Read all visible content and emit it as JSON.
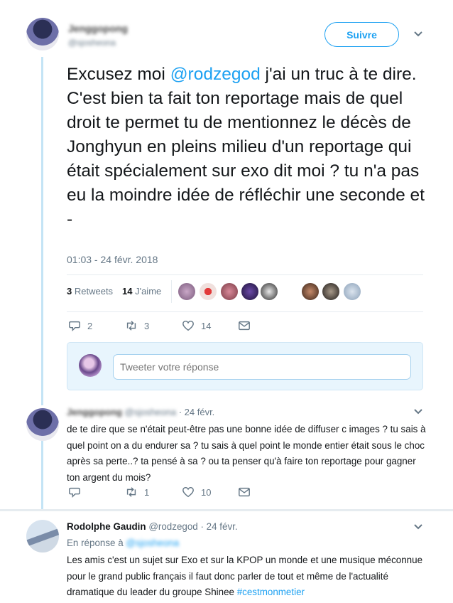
{
  "main_tweet": {
    "author_name": "Jenggopong",
    "author_handle": "@sjosheona",
    "follow_label": "Suivre",
    "text_prefix": "Excusez moi ",
    "mention": "@rodzegod",
    "text_rest": " j'ai un truc à te dire. C'est bien ta fait ton reportage mais de quel droit te permet tu de mentionnez le décès de Jonghyun en pleins milieu d'un reportage qui était spécialement sur exo dit moi ? tu n'a pas eu la moindre idée de réfléchir une seconde et -",
    "timestamp": "01:03 - 24 févr. 2018",
    "retweets_count": "3",
    "retweets_label": "Retweets",
    "likes_count": "14",
    "likes_label": "J'aime",
    "reply_count": "2",
    "retweet_count": "3",
    "like_count": "14",
    "reply_placeholder": "Tweeter votre réponse"
  },
  "reply1": {
    "author_name": "Jenggopong",
    "author_handle": "@sjosheona",
    "time": "· 24 févr.",
    "text": "de te dire que se n'était peut-être pas une bonne idée de diffuser c images ? tu sais à quel point on a du endurer sa ? tu sais à quel point le monde entier était sous le choc après sa perte..? ta pensé à sa ? ou ta penser qu'à faire ton reportage pour gagner ton argent du mois?",
    "retweet_count": "1",
    "like_count": "10"
  },
  "reply2": {
    "author_name": "Rodolphe Gaudin",
    "author_handle": "@rodzegod",
    "time": "· 24 févr.",
    "in_reply_prefix": "En réponse à",
    "in_reply_handle": "@sjosheona",
    "text": "Les amis c'est un sujet sur Exo et sur la KPOP un monde et une musique méconnue pour le grand public français il faut donc parler de tout et même de l'actualité dramatique du leader du groupe Shinee ",
    "hashtag": "#cestmonmetier"
  },
  "colors": {
    "accent": "#1da1f2",
    "thread_line": "#c4e4f5",
    "muted_text": "#657786",
    "border": "#e6ecf0"
  },
  "icons": [
    "caret-down-icon",
    "reply-icon",
    "retweet-icon",
    "heart-icon",
    "message-icon"
  ]
}
